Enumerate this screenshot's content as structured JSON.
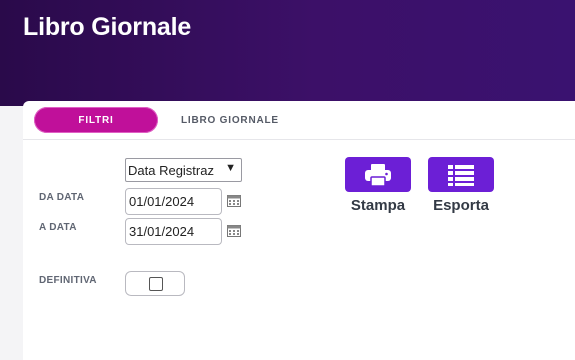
{
  "header": {
    "title": "Libro Giornale"
  },
  "tabs": [
    {
      "label": "FILTRI",
      "active": true
    },
    {
      "label": "LIBRO GIORNALE",
      "active": false
    }
  ],
  "filters": {
    "date_type": {
      "selected": "Data Registraz"
    },
    "from_date": {
      "label": "DA DATA",
      "value": "01/01/2024"
    },
    "to_date": {
      "label": "A DATA",
      "value": "31/01/2024"
    },
    "definitiva": {
      "label": "DEFINITIVA",
      "checked": false
    }
  },
  "actions": {
    "print_label": "Stampa",
    "export_label": "Esporta"
  },
  "colors": {
    "header_bg": "#3a1268",
    "active_tab": "#c0109a",
    "action_button": "#6c1fd6"
  },
  "icons": {
    "print": "printer-icon",
    "export": "list-icon",
    "calendar": "calendar-icon",
    "dropdown": "chevron-down-icon"
  }
}
